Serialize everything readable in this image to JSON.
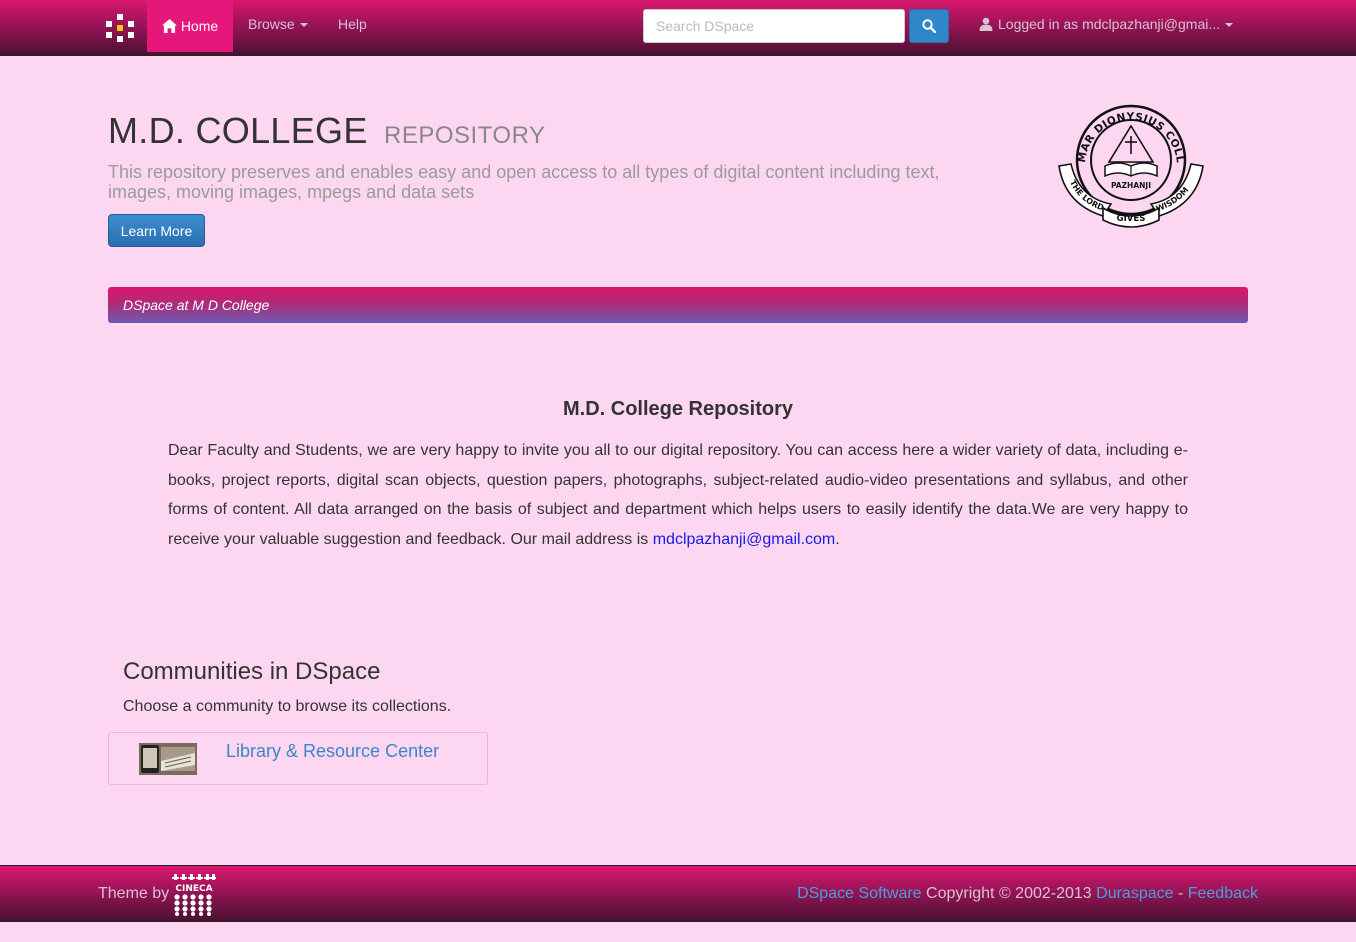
{
  "navbar": {
    "home_label": "Home",
    "browse_label": "Browse",
    "help_label": "Help",
    "search_placeholder": "Search DSpace",
    "user_label": "Logged in as mdclpazhanji@gmai..."
  },
  "jumbotron": {
    "title": "M.D. COLLEGE",
    "title_sub": "REPOSITORY",
    "description": "This repository preserves and enables easy and open access to all types of digital content including text, images, moving images, mpegs and data sets",
    "learn_more_label": "Learn More",
    "logo_text": {
      "ring_top": "MAR DIONYSIUS COLLEGE",
      "center": "PAZHANJI",
      "ribbon_left": "THE LORD",
      "ribbon_mid": "GIVES",
      "ribbon_right": "WISDOM"
    }
  },
  "breadcrumb": {
    "label": "DSpace at M D College"
  },
  "intro": {
    "title": "M.D. College Repository",
    "text": "Dear Faculty and Students, we are very happy to invite you all to our digital repository. You can access here a wider variety of data, including e-books, project reports, digital scan objects, question papers, photographs, subject-related audio-video presentations and syllabus, and other forms of content. All data arranged on the basis of subject and department which helps users to easily identify the data.We are very happy to receive your valuable suggestion and feedback. Our mail address is ",
    "email": "mdclpazhanji@gmail.com",
    "trailing": "."
  },
  "communities": {
    "title": "Communities in DSpace",
    "subtitle": "Choose a community to browse its collections.",
    "items": [
      {
        "label": "Library & Resource Center"
      }
    ]
  },
  "footer": {
    "theme_by": "Theme by",
    "cineca_text": "CINECA",
    "dspace_link": "DSpace Software",
    "copyright": " Copyright © 2002-2013 ",
    "duraspace_link": "Duraspace",
    "separator": " - ",
    "feedback_link": "Feedback"
  },
  "colors": {
    "page_background": "#fdd7f1",
    "navbar_gradient_top": "#d9176f",
    "navbar_gradient_bottom": "#4a1131",
    "active_tab": "#e5177a",
    "primary_button": "#2f86c8",
    "link": "#3d86c6"
  }
}
